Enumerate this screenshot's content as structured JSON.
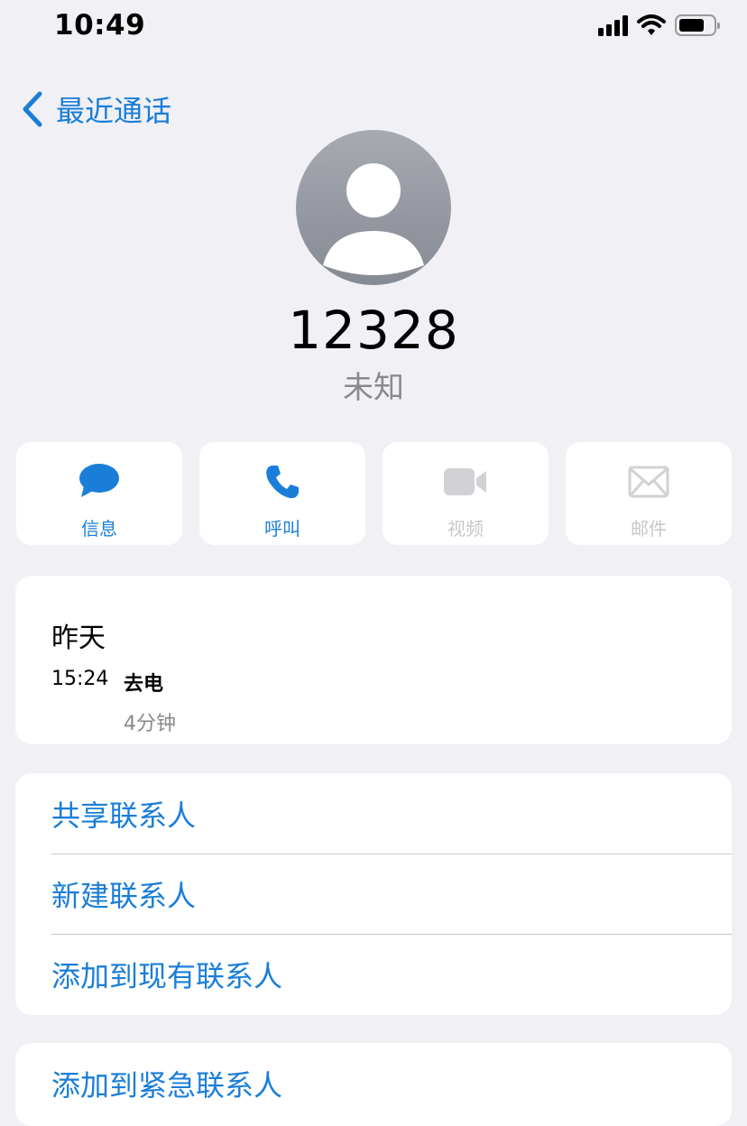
{
  "status_bar": {
    "time": "10:49",
    "icons": [
      "cellular-signal-icon",
      "wifi-icon",
      "battery-icon"
    ],
    "battery_level": 0.64
  },
  "nav": {
    "back_label": "最近通话"
  },
  "contact": {
    "number": "12328",
    "label": "未知"
  },
  "actions": [
    {
      "label": "信息",
      "icon": "message-icon",
      "enabled": true
    },
    {
      "label": "呼叫",
      "icon": "phone-icon",
      "enabled": true
    },
    {
      "label": "视频",
      "icon": "video-icon",
      "enabled": false
    },
    {
      "label": "邮件",
      "icon": "mail-icon",
      "enabled": false
    }
  ],
  "recent_calls": {
    "day": "昨天",
    "entries": [
      {
        "time": "15:24",
        "type": "去电",
        "duration": "4分钟"
      }
    ]
  },
  "options": [
    {
      "label": "共享联系人"
    },
    {
      "label": "新建联系人"
    },
    {
      "label": "添加到现有联系人"
    }
  ],
  "emergency": {
    "label": "添加到紧急联系人"
  },
  "colors": {
    "accent": "#1a7ed8",
    "disabled": "#c7c7cc",
    "background": "#f0f0f5",
    "secondary_text": "#8a8a8e"
  }
}
